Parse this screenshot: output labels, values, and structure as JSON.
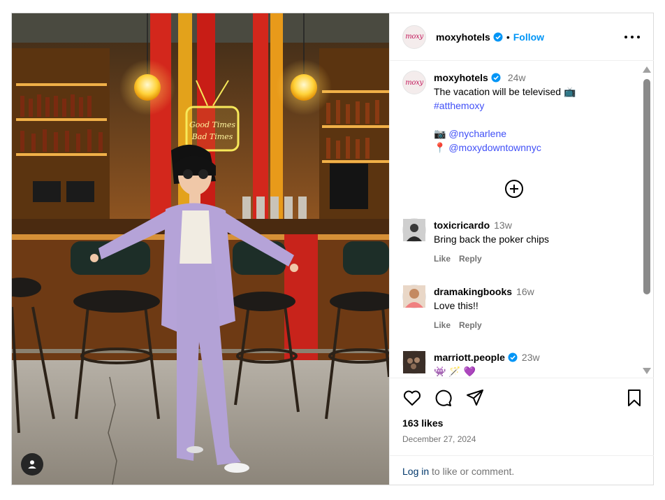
{
  "post": {
    "username": "moxyhotels",
    "follow_label": "Follow",
    "separator": "•",
    "avatar_text": "moxy",
    "caption": {
      "time": "24w",
      "text": "The vacation will be televised 📺",
      "hashtag": "#atthemoxy",
      "photo_credit_emoji": "📷",
      "photo_credit_handle": "@nycharlene",
      "location_emoji": "📍",
      "location_handle": "@moxydowntownnyc"
    },
    "neon_sign": [
      "Good Times",
      "Bad Times"
    ],
    "comments": [
      {
        "username": "toxicricardo",
        "time": "13w",
        "text": "Bring back the poker chips",
        "like_label": "Like",
        "reply_label": "Reply",
        "verified": false
      },
      {
        "username": "dramakingbooks",
        "time": "16w",
        "text": "Love this!!",
        "like_label": "Like",
        "reply_label": "Reply",
        "verified": false
      },
      {
        "username": "marriott.people",
        "time": "23w",
        "text": "👾 🪄 💜",
        "verified": true
      }
    ],
    "likes": "163 likes",
    "date": "December 27, 2024",
    "login_link": "Log in",
    "login_rest": " to like or comment."
  },
  "colors": {
    "accent": "#0095f6",
    "verified": "#0095f6",
    "link": "#4150f7",
    "muted": "#737373"
  },
  "icons": [
    "more-icon",
    "verified-icon",
    "load-more-icon",
    "heart-icon",
    "comment-icon",
    "share-icon",
    "bookmark-icon",
    "user-tag-icon"
  ]
}
